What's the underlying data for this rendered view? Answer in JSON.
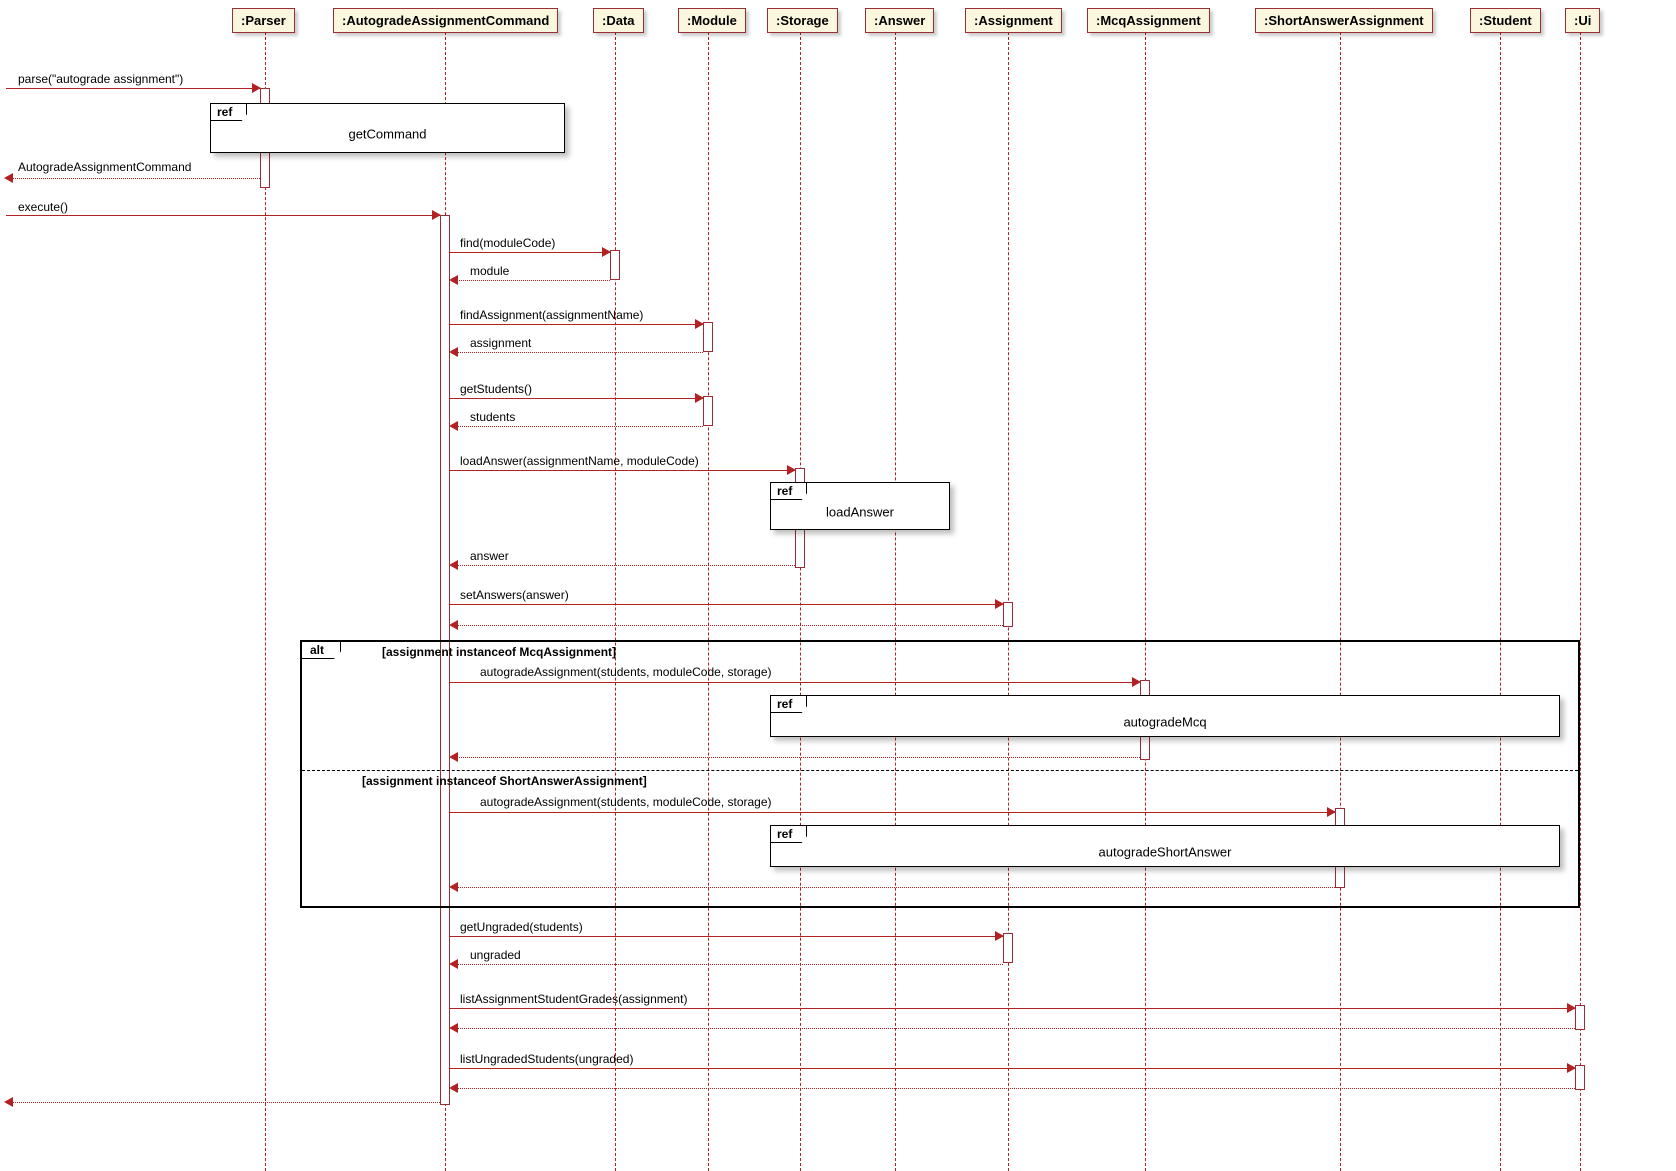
{
  "participants": {
    "parser": ":Parser",
    "cmd": ":AutogradeAssignmentCommand",
    "data": ":Data",
    "module": ":Module",
    "storage": ":Storage",
    "answer": ":Answer",
    "assignment": ":Assignment",
    "mcq": ":McqAssignment",
    "short": ":ShortAnswerAssignment",
    "student": ":Student",
    "ui": ":Ui"
  },
  "messages": {
    "parse": "parse(\"autograde assignment\")",
    "ret_cmd": "AutogradeAssignmentCommand",
    "execute": "execute()",
    "find": "find(moduleCode)",
    "ret_module": "module",
    "findAssignment": "findAssignment(assignmentName)",
    "ret_assignment": "assignment",
    "getStudents": "getStudents()",
    "ret_students": "students",
    "loadAnswer": "loadAnswer(assignmentName, moduleCode)",
    "ret_answer": "answer",
    "setAnswers": "setAnswers(answer)",
    "autograde1": "autogradeAssignment(students, moduleCode, storage)",
    "autograde2": "autogradeAssignment(students, moduleCode, storage)",
    "getUngraded": "getUngraded(students)",
    "ret_ungraded": "ungraded",
    "listGrades": "listAssignmentStudentGrades(assignment)",
    "listUngraded": "listUngradedStudents(ungraded)"
  },
  "refs": {
    "tag": "ref",
    "getCommand": "getCommand",
    "loadAnswer": "loadAnswer",
    "autogradeMcq": "autogradeMcq",
    "autogradeShort": "autogradeShortAnswer"
  },
  "alt": {
    "tag": "alt",
    "guard1": "[assignment instanceof McqAssignment]",
    "guard2": "[assignment instanceof ShortAnswerAssignment]"
  }
}
